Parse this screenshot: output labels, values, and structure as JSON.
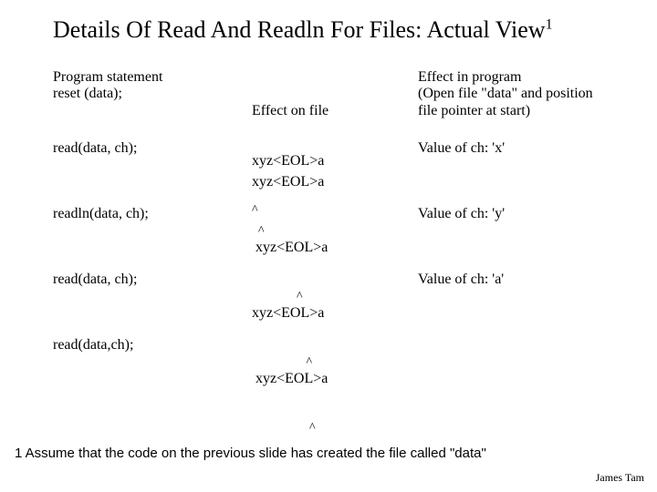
{
  "title_main": "Details Of Read And Readln For Files: Actual View",
  "title_sup": "1",
  "header": {
    "c1a": "Program statement",
    "c1b": "reset (data);",
    "c2a": "Effect on file",
    "c2b": "xyz<EOL>a",
    "c2c": "^",
    "c3a": "Effect in program",
    "c3b": "(Open file \"data\" and position",
    "c3c": "file pointer at start)"
  },
  "rows": [
    {
      "stmt": "read(data, ch);",
      "file": "xyz<EOL>a",
      "caret": "  ^",
      "effect": "Value of ch: 'x'"
    },
    {
      "stmt": "readln(data, ch);",
      "file": " xyz<EOL>a",
      "caret": "              ^",
      "effect": "Value of ch: 'y'"
    },
    {
      "stmt": "read(data, ch);",
      "file": "xyz<EOL>a",
      "caret": "                 ^",
      "effect": "Value of ch: 'a'"
    },
    {
      "stmt": "read(data,ch);",
      "file": " xyz<EOL>a",
      "caret": "                  ^",
      "effect": ""
    }
  ],
  "footnote": "1 Assume that the code on the previous slide has created the file called \"data\"",
  "author": "James Tam"
}
